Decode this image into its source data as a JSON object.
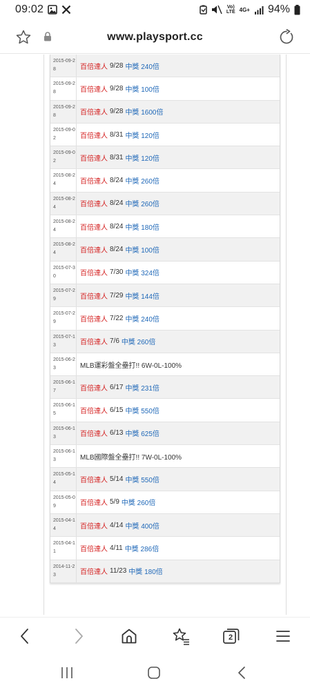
{
  "status_bar": {
    "time": "09:02",
    "battery_pct": "94%",
    "network_label_top": "Vo)",
    "network_label_bottom": "LTE",
    "network_gen": "4G+"
  },
  "browser": {
    "url": "www.playsport.cc"
  },
  "rows": [
    {
      "date": "2015-09-28",
      "prefix": "百倍達人",
      "mid": "9/28",
      "suffix": "中獎 240倍"
    },
    {
      "date": "2015-09-28",
      "prefix": "百倍達人",
      "mid": "9/28",
      "suffix": "中獎 100倍"
    },
    {
      "date": "2015-09-28",
      "prefix": "百倍達人",
      "mid": "9/28",
      "suffix": "中獎 1600倍"
    },
    {
      "date": "2015-09-02",
      "prefix": "百倍達人",
      "mid": "8/31",
      "suffix": "中獎 120倍"
    },
    {
      "date": "2015-09-02",
      "prefix": "百倍達人",
      "mid": "8/31",
      "suffix": "中獎 120倍"
    },
    {
      "date": "2015-08-24",
      "prefix": "百倍達人",
      "mid": "8/24",
      "suffix": "中獎 260倍"
    },
    {
      "date": "2015-08-24",
      "prefix": "百倍達人",
      "mid": "8/24",
      "suffix": "中獎 260倍"
    },
    {
      "date": "2015-08-24",
      "prefix": "百倍達人",
      "mid": "8/24",
      "suffix": "中獎 180倍"
    },
    {
      "date": "2015-08-24",
      "prefix": "百倍達人",
      "mid": "8/24",
      "suffix": "中獎 100倍"
    },
    {
      "date": "2015-07-30",
      "prefix": "百倍達人",
      "mid": "7/30",
      "suffix": "中獎 324倍"
    },
    {
      "date": "2015-07-29",
      "prefix": "百倍達人",
      "mid": "7/29",
      "suffix": "中獎 144倍"
    },
    {
      "date": "2015-07-29",
      "prefix": "百倍達人",
      "mid": "7/22",
      "suffix": "中獎 240倍"
    },
    {
      "date": "2015-07-13",
      "prefix": "百倍達人",
      "mid": "7/6",
      "suffix": "中獎 260倍"
    },
    {
      "date": "2015-06-23",
      "prefix": "",
      "mid": "MLB運彩盤全壘打!! 6W-0L-100%",
      "suffix": ""
    },
    {
      "date": "2015-06-17",
      "prefix": "百倍達人",
      "mid": "6/17",
      "suffix": "中獎 231倍"
    },
    {
      "date": "2015-06-15",
      "prefix": "百倍達人",
      "mid": "6/15",
      "suffix": "中獎 550倍"
    },
    {
      "date": "2015-06-13",
      "prefix": "百倍達人",
      "mid": "6/13",
      "suffix": "中獎 625倍"
    },
    {
      "date": "2015-06-13",
      "prefix": "",
      "mid": "MLB國際盤全壘打!! 7W-0L-100%",
      "suffix": ""
    },
    {
      "date": "2015-05-14",
      "prefix": "百倍達人",
      "mid": "5/14",
      "suffix": "中獎 550倍"
    },
    {
      "date": "2015-05-09",
      "prefix": "百倍達人",
      "mid": "5/9",
      "suffix": "中獎 260倍"
    },
    {
      "date": "2015-04-14",
      "prefix": "百倍達人",
      "mid": "4/14",
      "suffix": "中獎 400倍"
    },
    {
      "date": "2015-04-11",
      "prefix": "百倍達人",
      "mid": "4/11",
      "suffix": "中獎 286倍"
    },
    {
      "date": "2014-11-23",
      "prefix": "百倍達人",
      "mid": "11/23",
      "suffix": "中獎 180倍"
    }
  ],
  "bottom_nav": {
    "tab_count": "2"
  },
  "colors": {
    "prefix": "#d42020",
    "suffix": "#1f68b8",
    "odd_row": "#f1f1f1"
  }
}
